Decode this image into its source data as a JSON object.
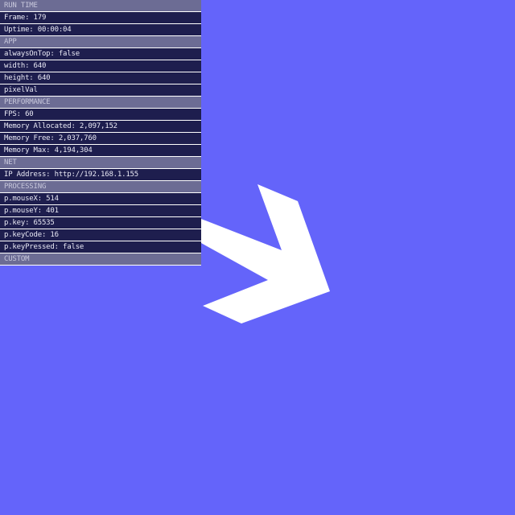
{
  "colors": {
    "background": "#6464fa",
    "arrow": "#ffffff",
    "arrow_shadow": "#5a5a5a",
    "section_header_bg": "#6c6c94",
    "row_bg": "#1e1e4e",
    "row_text": "#e8e8f4",
    "divider": "#ffffff"
  },
  "canvas": {
    "shape": "arrow-chevron-icon"
  },
  "debug_panel": {
    "rows": [
      {
        "type": "header",
        "name": "section-header-runtime",
        "text": "RUN TIME"
      },
      {
        "type": "item",
        "name": "runtime-frame",
        "text": "Frame: 179"
      },
      {
        "type": "item",
        "name": "runtime-uptime",
        "text": "Uptime: 00:00:04"
      },
      {
        "type": "header",
        "name": "section-header-app",
        "text": "APP"
      },
      {
        "type": "item",
        "name": "app-always-on-top",
        "text": "alwaysOnTop: false"
      },
      {
        "type": "item",
        "name": "app-width",
        "text": "width: 640"
      },
      {
        "type": "item",
        "name": "app-height",
        "text": "height: 640"
      },
      {
        "type": "item",
        "name": "app-pixel-val",
        "text": "pixelVal"
      },
      {
        "type": "header",
        "name": "section-header-performance",
        "text": "PERFORMANCE"
      },
      {
        "type": "item",
        "name": "performance-fps",
        "text": "FPS: 60"
      },
      {
        "type": "item",
        "name": "performance-memory-allocated",
        "text": "Memory Allocated: 2,097,152"
      },
      {
        "type": "item",
        "name": "performance-memory-free",
        "text": "Memory Free: 2,037,760"
      },
      {
        "type": "item",
        "name": "performance-memory-max",
        "text": "Memory Max: 4,194,304"
      },
      {
        "type": "header",
        "name": "section-header-net",
        "text": "NET"
      },
      {
        "type": "item",
        "name": "net-ip-address",
        "text": "IP Address: http://192.168.1.155"
      },
      {
        "type": "header",
        "name": "section-header-processing",
        "text": "PROCESSING"
      },
      {
        "type": "item",
        "name": "processing-mouse-x",
        "text": "p.mouseX: 514"
      },
      {
        "type": "item",
        "name": "processing-mouse-y",
        "text": "p.mouseY: 401"
      },
      {
        "type": "item",
        "name": "processing-key",
        "text": "p.key: 65535"
      },
      {
        "type": "item",
        "name": "processing-key-code",
        "text": "p.keyCode: 16"
      },
      {
        "type": "item",
        "name": "processing-key-pressed",
        "text": "p.keyPressed: false"
      },
      {
        "type": "header",
        "name": "section-header-custom",
        "text": "CUSTOM"
      }
    ]
  }
}
